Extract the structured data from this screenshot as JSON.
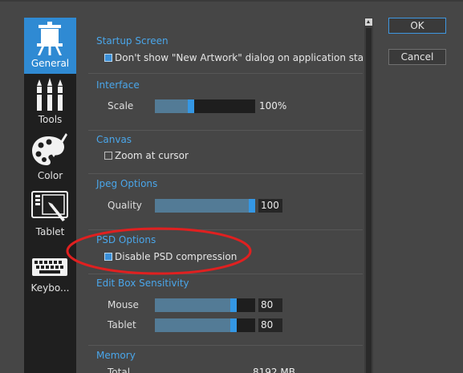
{
  "sidebar": {
    "items": [
      {
        "label": "General",
        "icon": "easel-icon",
        "active": true
      },
      {
        "label": "Tools",
        "icon": "brushes-icon",
        "active": false
      },
      {
        "label": "Color",
        "icon": "palette-icon",
        "active": false
      },
      {
        "label": "Tablet",
        "icon": "tablet-icon",
        "active": false
      },
      {
        "label": "Keybo...",
        "icon": "keyboard-icon",
        "active": false
      }
    ]
  },
  "sections": {
    "startup": {
      "title": "Startup Screen",
      "checkbox_label": "Don't show \"New Artwork\" dialog on application startup",
      "checked": true
    },
    "interface": {
      "title": "Interface",
      "scale_label": "Scale",
      "scale_value": "100%",
      "scale_level": 0.35
    },
    "canvas": {
      "title": "Canvas",
      "zoom_label": "Zoom at cursor",
      "checked": false
    },
    "jpeg": {
      "title": "Jpeg Options",
      "quality_label": "Quality",
      "quality_value": "100",
      "quality_level": 1.0
    },
    "psd": {
      "title": "PSD Options",
      "compression_label": "Disable PSD compression",
      "checked": true
    },
    "edit_box": {
      "title": "Edit Box Sensitivity",
      "mouse_label": "Mouse",
      "mouse_value": "80",
      "mouse_level": 0.8,
      "tablet_label": "Tablet",
      "tablet_value": "80",
      "tablet_level": 0.8
    },
    "memory": {
      "title": "Memory",
      "total_label": "Total",
      "total_value": "8192 MB"
    }
  },
  "buttons": {
    "ok": "OK",
    "cancel": "Cancel"
  },
  "colors": {
    "accent": "#2f8ad3",
    "section_title": "#4aa6ea",
    "annotation": "#e02020"
  }
}
